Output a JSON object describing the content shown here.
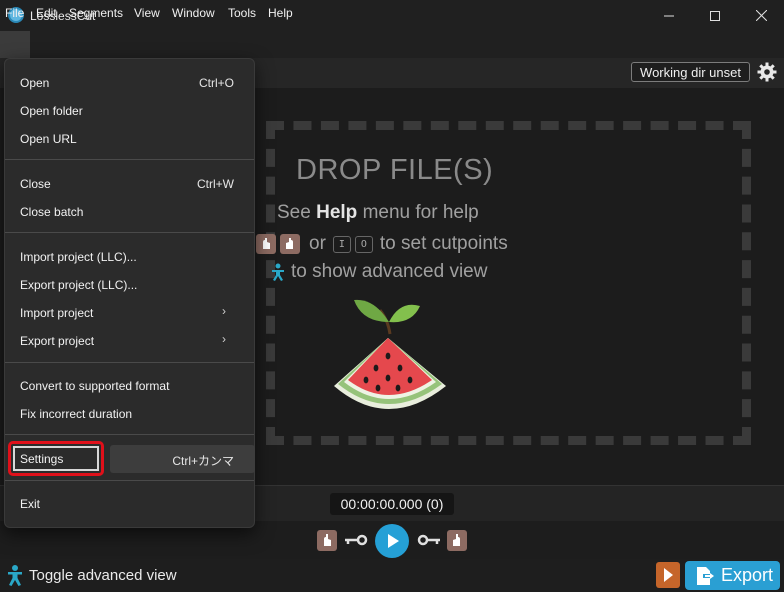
{
  "window": {
    "title": "LosslessCut"
  },
  "menubar": [
    "File",
    "Edit",
    "Segments",
    "View",
    "Window",
    "Tools",
    "Help"
  ],
  "toolbar": {
    "working_dir_label": "Working dir unset"
  },
  "dropzone": {
    "title": "DROP FILE(S)",
    "help_prefix": "See",
    "help_bold": "Help",
    "help_suffix": "menu for help",
    "or_text": "or",
    "key_in": "I",
    "key_out": "O",
    "cut_text": "to set cutpoints",
    "adv_text": "to show advanced view"
  },
  "timeline": {
    "timecode": "00:00:00.000 (0)"
  },
  "bottom": {
    "toggle_label": "Toggle advanced view",
    "export_label": "Export"
  },
  "file_menu": {
    "open": "Open",
    "open_acc": "Ctrl+O",
    "open_folder": "Open folder",
    "open_url": "Open URL",
    "close": "Close",
    "close_acc": "Ctrl+W",
    "close_batch": "Close batch",
    "import_llc": "Import project (LLC)...",
    "export_llc": "Export project (LLC)...",
    "import_project": "Import project",
    "export_project": "Export project",
    "convert": "Convert to supported format",
    "fix_duration": "Fix incorrect duration",
    "settings": "Settings",
    "settings_acc": "Ctrl+カンマ",
    "exit": "Exit",
    "arrow": "›"
  },
  "colors": {
    "accent": "#2a9fd3",
    "highlight": "#e0101a",
    "cut_icon": "#8d6b62"
  }
}
